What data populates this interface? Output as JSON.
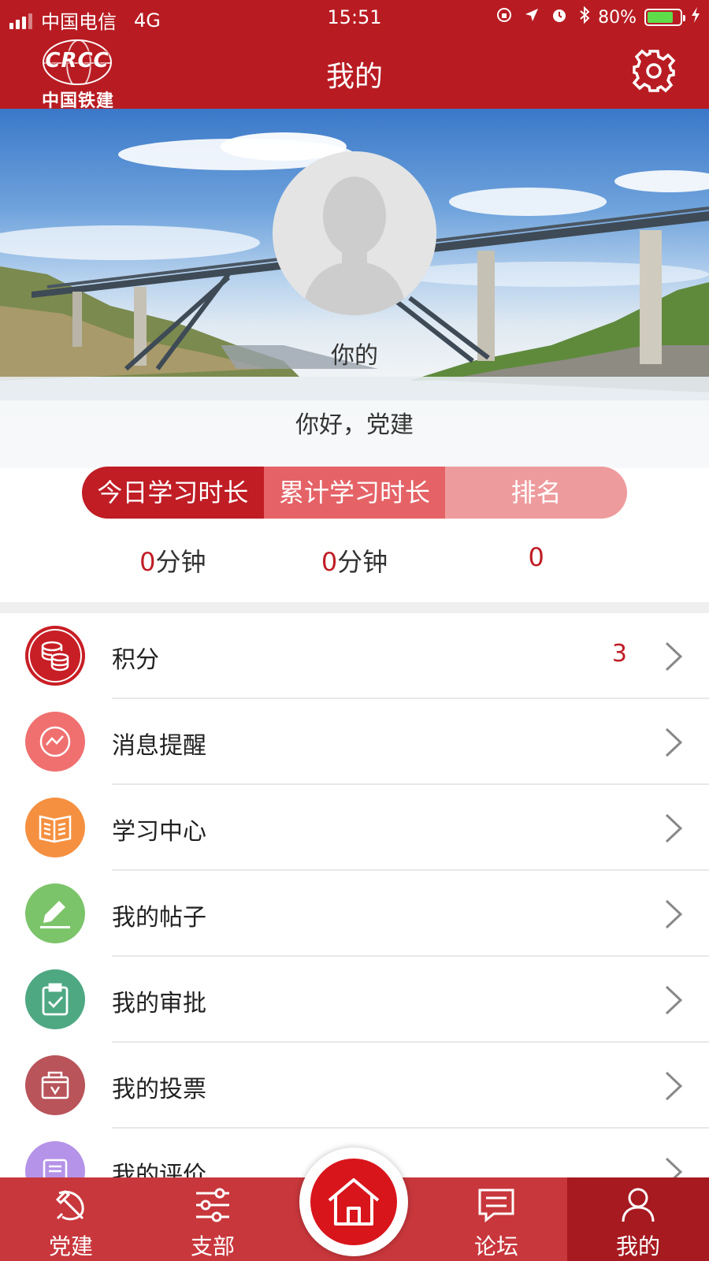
{
  "status_bar": {
    "carrier": "中国电信",
    "network": "4G",
    "time": "15:51",
    "battery": "80%",
    "battery_level": 0.8
  },
  "nav": {
    "logo_mark": "CRCC",
    "logo_text": "中国铁建",
    "title": "我的"
  },
  "profile": {
    "name": "你的",
    "greeting": "你好，党建"
  },
  "stats": {
    "tabs": [
      "今日学习时长",
      "累计学习时长",
      "排名"
    ],
    "values": [
      {
        "num": "0",
        "unit": "分钟"
      },
      {
        "num": "0",
        "unit": "分钟"
      },
      {
        "num": "0",
        "unit": ""
      }
    ]
  },
  "menu": [
    {
      "label": "积分",
      "badge": "3",
      "icon": "coins-icon",
      "color": "#c81e25"
    },
    {
      "label": "消息提醒",
      "badge": "",
      "icon": "chart-icon",
      "color": "#f07070"
    },
    {
      "label": "学习中心",
      "badge": "",
      "icon": "book-icon",
      "color": "#f59040"
    },
    {
      "label": "我的帖子",
      "badge": "",
      "icon": "pencil-icon",
      "color": "#7cc46a"
    },
    {
      "label": "我的审批",
      "badge": "",
      "icon": "clipboard-check-icon",
      "color": "#4ea882"
    },
    {
      "label": "我的投票",
      "badge": "",
      "icon": "ballot-box-icon",
      "color": "#b8545a"
    },
    {
      "label": "我的评价",
      "badge": "",
      "icon": "comment-icon",
      "color": "#b593e8"
    }
  ],
  "tabbar": {
    "tabs": [
      {
        "label": "党建",
        "icon": "hammer-sickle-icon"
      },
      {
        "label": "支部",
        "icon": "sliders-icon"
      },
      {
        "label": "论坛",
        "icon": "message-icon"
      },
      {
        "label": "我的",
        "icon": "user-icon"
      }
    ],
    "home_icon": "home-icon",
    "active": "我的"
  },
  "colors": {
    "brand_red": "#b81c22",
    "accent_red": "#c01d25",
    "tab_bar": "#c8373c"
  }
}
